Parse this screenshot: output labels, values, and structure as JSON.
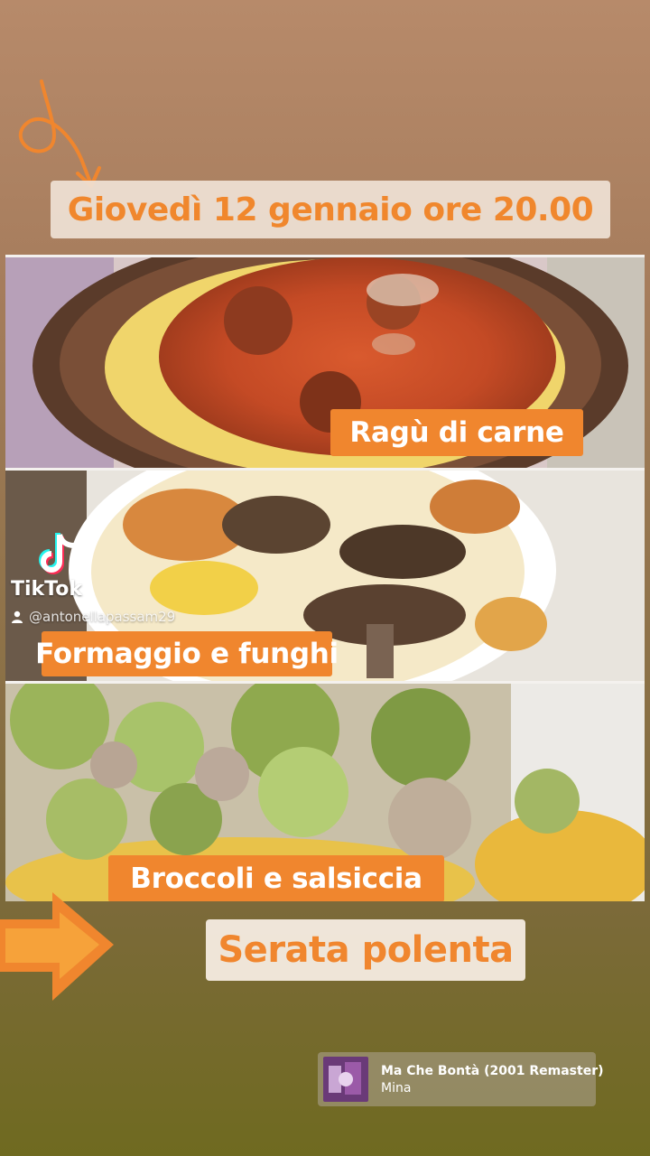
{
  "header": {
    "date_text": "Giovedì 12 gennaio ore 20.00"
  },
  "dishes": [
    {
      "label": "Ragù di carne"
    },
    {
      "label": "Formaggio e funghi"
    },
    {
      "label": "Broccoli e salsiccia"
    }
  ],
  "event": {
    "title": "Serata polenta"
  },
  "tiktok": {
    "brand": "TikTok",
    "username": "@antonellapassam29"
  },
  "music": {
    "song_title": "Ma Che Bontà (2001 Remaster)",
    "artist": "Mina"
  },
  "colors": {
    "accent_orange": "#f0862e",
    "pill_background": "#efe2d6"
  },
  "icons": [
    "swirl-arrow-icon",
    "tiktok-logo-icon",
    "user-icon",
    "right-arrow-icon",
    "album-art-icon"
  ]
}
